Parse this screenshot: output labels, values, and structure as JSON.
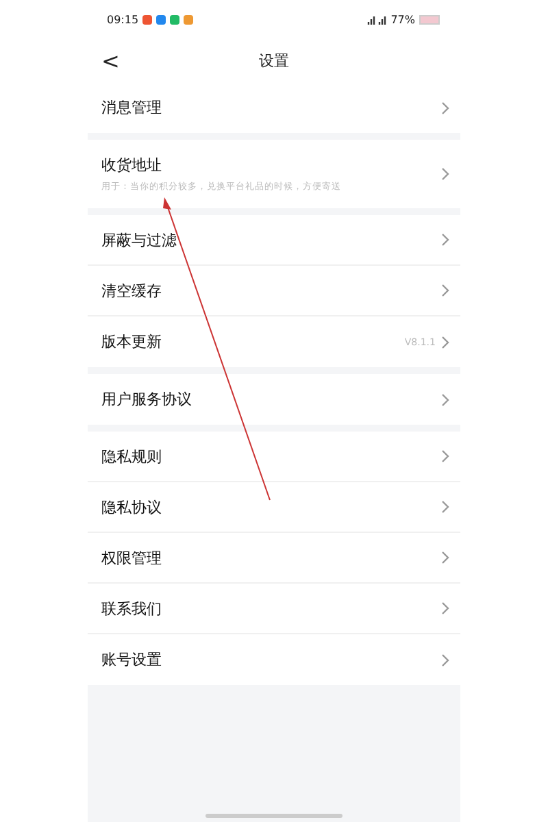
{
  "status_bar": {
    "time": "09:15",
    "battery": "77%"
  },
  "header": {
    "back": "<",
    "title": "设置"
  },
  "groups": [
    {
      "items": [
        {
          "label": "消息管理"
        }
      ]
    },
    {
      "items": [
        {
          "label": "收货地址",
          "subtitle": "用于：当你的积分较多，兑换平台礼品的时候，方便寄送"
        }
      ]
    },
    {
      "items": [
        {
          "label": "屏蔽与过滤"
        },
        {
          "label": "清空缓存"
        },
        {
          "label": "版本更新",
          "value": "V8.1.1"
        }
      ]
    },
    {
      "items": [
        {
          "label": "用户服务协议"
        }
      ]
    },
    {
      "items": [
        {
          "label": "隐私规则"
        },
        {
          "label": "隐私协议"
        },
        {
          "label": "权限管理"
        },
        {
          "label": "联系我们"
        },
        {
          "label": "账号设置"
        }
      ]
    }
  ]
}
